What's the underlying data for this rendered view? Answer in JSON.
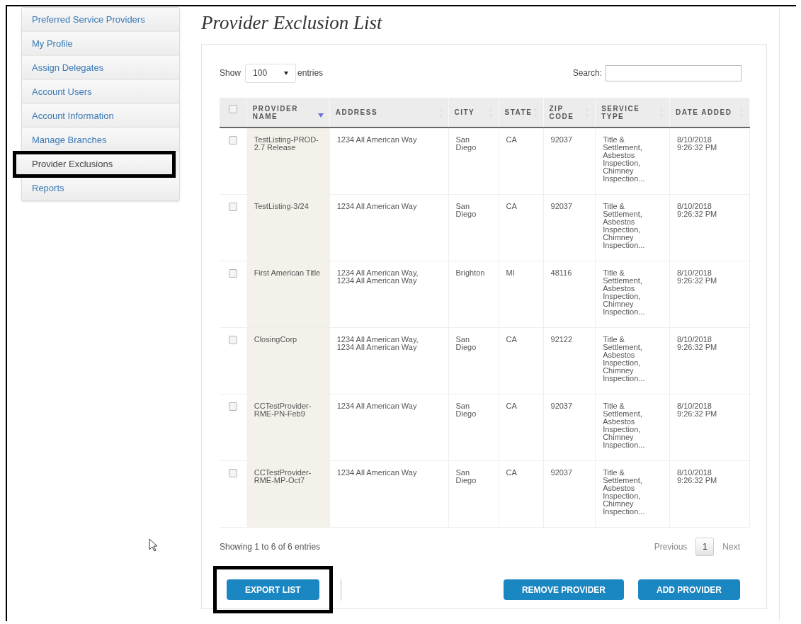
{
  "sidebar": {
    "items": [
      {
        "label": "Preferred Service Providers",
        "selected": false,
        "highlighted": false
      },
      {
        "label": "My Profile",
        "selected": false,
        "highlighted": false
      },
      {
        "label": "Assign Delegates",
        "selected": false,
        "highlighted": false
      },
      {
        "label": "Account Users",
        "selected": false,
        "highlighted": false
      },
      {
        "label": "Account Information",
        "selected": false,
        "highlighted": false
      },
      {
        "label": "Manage Branches",
        "selected": false,
        "highlighted": false
      },
      {
        "label": "Provider Exclusions",
        "selected": true,
        "highlighted": true
      },
      {
        "label": "Reports",
        "selected": false,
        "highlighted": false
      }
    ]
  },
  "title": "Provider Exclusion List",
  "controls": {
    "show_label": "Show",
    "page_length": "100",
    "entries_label": "entries",
    "search_label": "Search:"
  },
  "table": {
    "select_all_checked": false,
    "columns": [
      {
        "label": "PROVIDER NAME",
        "sorted": true
      },
      {
        "label": "ADDRESS",
        "sorted": false
      },
      {
        "label": "CITY",
        "sorted": false
      },
      {
        "label": "STATE",
        "sorted": false
      },
      {
        "label": "ZIP CODE",
        "sorted": false
      },
      {
        "label": "SERVICE TYPE",
        "sorted": false
      },
      {
        "label": "DATE ADDED",
        "sorted": false
      }
    ],
    "rows": [
      {
        "checked": false,
        "cells": [
          "TestListing-PROD-2.7 Release",
          "1234 All American Way",
          "San Diego",
          "CA",
          "92037",
          "Title & Settlement, Asbestos Inspection, Chimney Inspection...",
          "8/10/2018 9:26:32 PM"
        ]
      },
      {
        "checked": false,
        "cells": [
          "TestListing-3/24",
          "1234 All American Way",
          "San Diego",
          "CA",
          "92037",
          "Title & Settlement, Asbestos Inspection, Chimney Inspection...",
          "8/10/2018 9:26:32 PM"
        ]
      },
      {
        "checked": false,
        "cells": [
          "First American Title",
          "1234 All American Way, 1234 All American Way",
          "Brighton",
          "MI",
          "48116",
          "Title & Settlement, Asbestos Inspection, Chimney Inspection...",
          "8/10/2018 9:26:32 PM"
        ]
      },
      {
        "checked": false,
        "cells": [
          "ClosingCorp",
          "1234 All American Way, 1234 All American Way",
          "San Diego",
          "CA",
          "92122",
          "Title & Settlement, Asbestos Inspection, Chimney Inspection...",
          "8/10/2018 9:26:32 PM"
        ]
      },
      {
        "checked": false,
        "cells": [
          "CCTestProvider-RME-PN-Feb9",
          "1234 All American Way",
          "San Diego",
          "CA",
          "92037",
          "Title & Settlement, Asbestos Inspection, Chimney Inspection...",
          "8/10/2018 9:26:32 PM"
        ]
      },
      {
        "checked": false,
        "cells": [
          "CCTestProvider-RME-MP-Oct7",
          "1234 All American Way",
          "San Diego",
          "CA",
          "92037",
          "Title & Settlement, Asbestos Inspection, Chimney Inspection...",
          "8/10/2018 9:26:32 PM"
        ]
      }
    ]
  },
  "info": "Showing 1 to 6 of 6 entries",
  "pagination": {
    "previous": "Previous",
    "pages": [
      {
        "label": "1",
        "selected": true
      }
    ],
    "next": "Next"
  },
  "buttons": [
    {
      "label": "EXPORT LIST",
      "highlighted": true
    },
    {
      "label": "REMOVE PROVIDER",
      "highlighted": false
    },
    {
      "label": "ADD PROVIDER",
      "highlighted": false
    }
  ]
}
